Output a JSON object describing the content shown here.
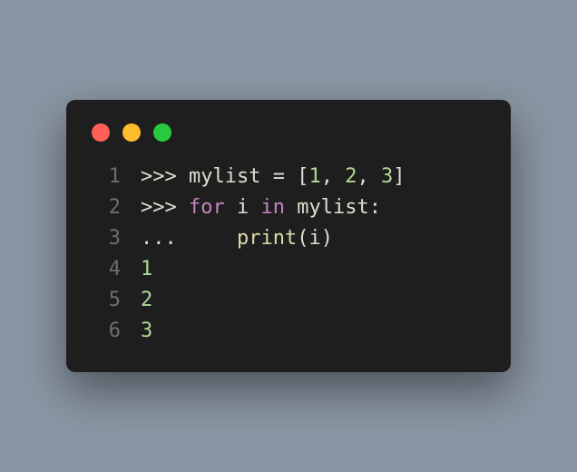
{
  "window": {
    "dots": [
      "red",
      "yellow",
      "green"
    ]
  },
  "code": {
    "lines": [
      {
        "no": "1",
        "tokens": [
          {
            "t": ">>> ",
            "c": "tok-prompt"
          },
          {
            "t": "mylist ",
            "c": "tok-name"
          },
          {
            "t": "= ",
            "c": "tok-op"
          },
          {
            "t": "[",
            "c": "tok-punct"
          },
          {
            "t": "1",
            "c": "tok-num"
          },
          {
            "t": ", ",
            "c": "tok-punct"
          },
          {
            "t": "2",
            "c": "tok-num"
          },
          {
            "t": ", ",
            "c": "tok-punct"
          },
          {
            "t": "3",
            "c": "tok-num"
          },
          {
            "t": "]",
            "c": "tok-punct"
          }
        ]
      },
      {
        "no": "2",
        "tokens": [
          {
            "t": ">>> ",
            "c": "tok-prompt"
          },
          {
            "t": "for ",
            "c": "tok-kw"
          },
          {
            "t": "i ",
            "c": "tok-name"
          },
          {
            "t": "in ",
            "c": "tok-kw"
          },
          {
            "t": "mylist",
            "c": "tok-name"
          },
          {
            "t": ":",
            "c": "tok-punct"
          }
        ]
      },
      {
        "no": "3",
        "tokens": [
          {
            "t": "...     ",
            "c": "tok-prompt"
          },
          {
            "t": "print",
            "c": "tok-func"
          },
          {
            "t": "(",
            "c": "tok-punct"
          },
          {
            "t": "i",
            "c": "tok-name"
          },
          {
            "t": ")",
            "c": "tok-punct"
          }
        ]
      },
      {
        "no": "4",
        "tokens": [
          {
            "t": "1",
            "c": "tok-out"
          }
        ]
      },
      {
        "no": "5",
        "tokens": [
          {
            "t": "2",
            "c": "tok-out"
          }
        ]
      },
      {
        "no": "6",
        "tokens": [
          {
            "t": "3",
            "c": "tok-out"
          }
        ]
      }
    ]
  }
}
